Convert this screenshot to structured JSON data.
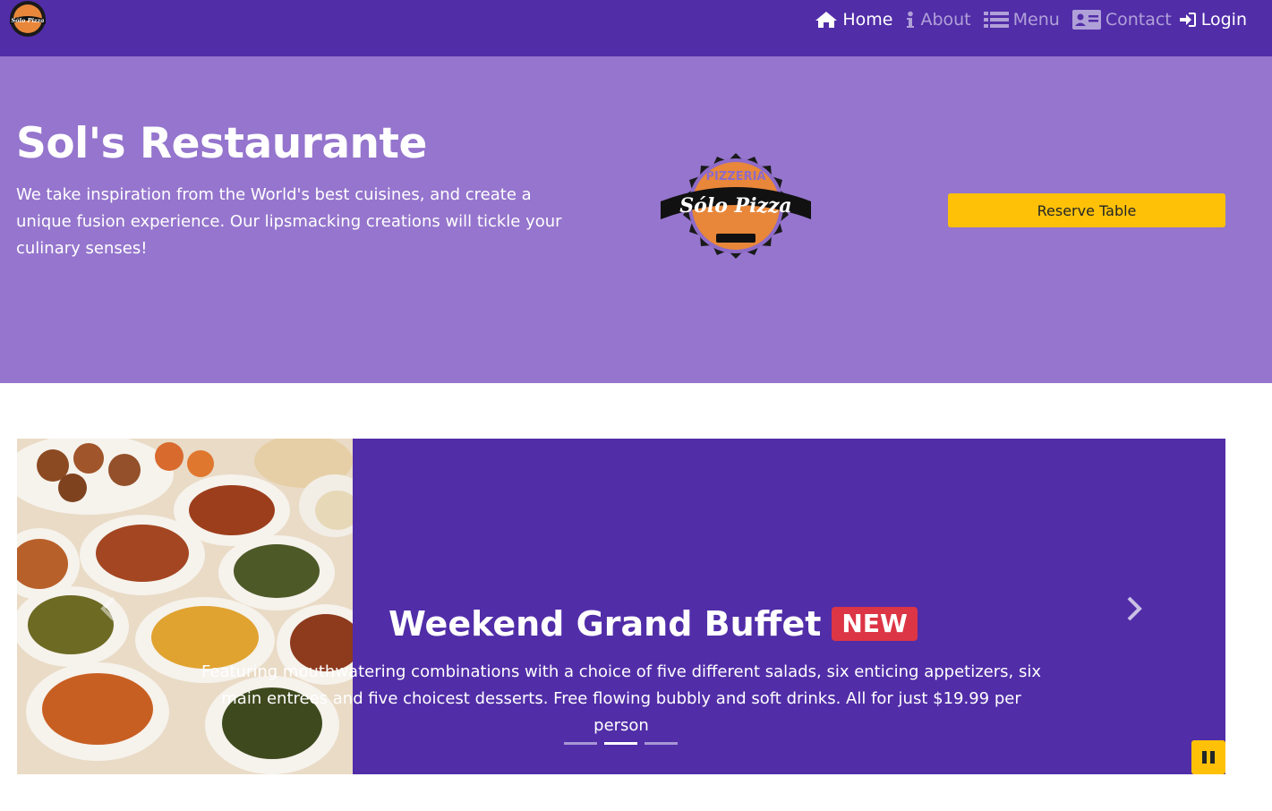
{
  "navbar": {
    "brand_logo_text": "Sólo Pizza",
    "items": [
      {
        "label": "Home",
        "icon": "home-icon",
        "active": true
      },
      {
        "label": "About",
        "icon": "info-icon",
        "active": false
      },
      {
        "label": "Menu",
        "icon": "list-icon",
        "active": false
      },
      {
        "label": "Contact",
        "icon": "address-card-icon",
        "active": false
      }
    ],
    "login_label": "Login"
  },
  "jumbotron": {
    "title": "Sol's Restaurante",
    "text": "We take inspiration from the World's best cuisines, and create a unique fusion experience. Our lipsmacking creations will tickle your culinary senses!",
    "logo_text": "Sólo Pizza",
    "logo_top_text": "PIZZERIA",
    "reserve_label": "Reserve Table"
  },
  "carousel": {
    "title": "Weekend Grand Buffet",
    "badge": "NEW",
    "text": "Featuring mouthwatering combinations with a choice of five different salads, six enticing appetizers, six main entrees and five choicest desserts. Free flowing bubbly and soft drinks. All for just $19.99 per person",
    "indicators": 3,
    "active_index": 1
  },
  "colors": {
    "primary_dark": "#512DA8",
    "primary_light": "#9575CD",
    "accent": "#FFC107",
    "badge": "#DC3545"
  }
}
